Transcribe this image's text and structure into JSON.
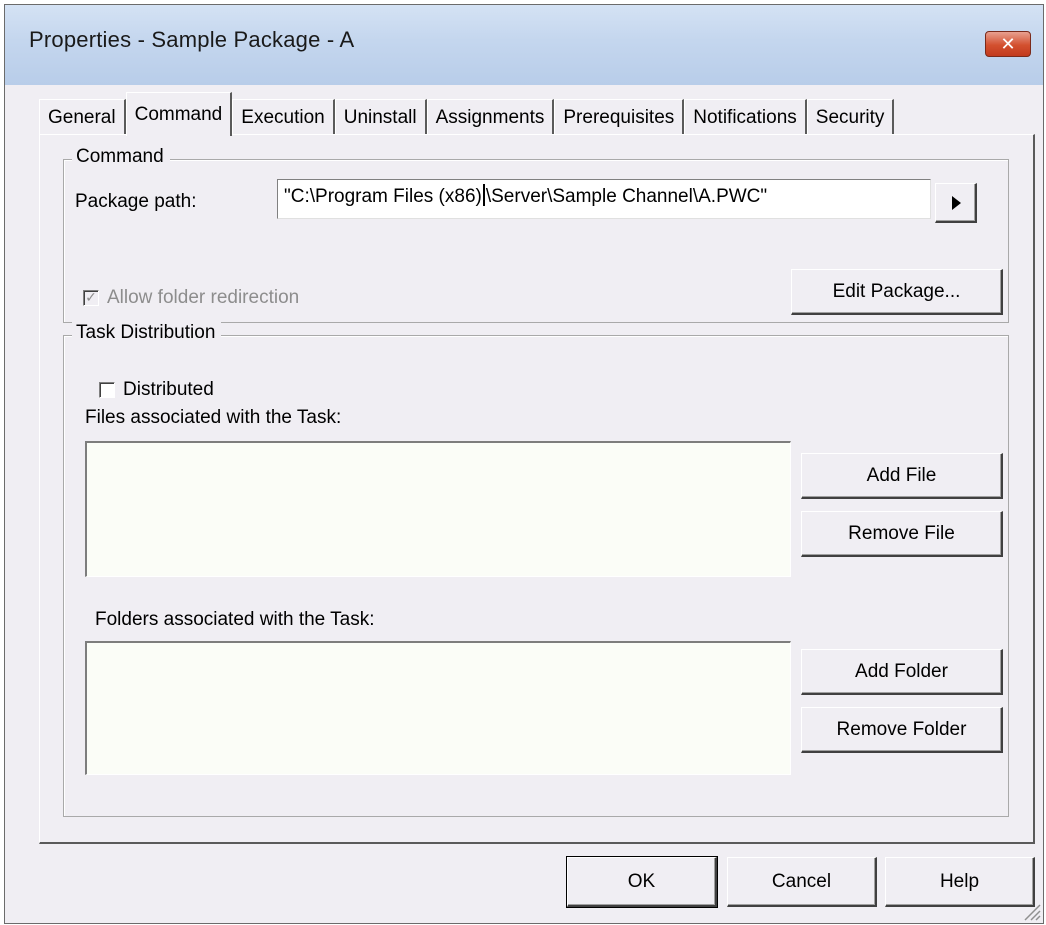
{
  "window": {
    "title": "Properties - Sample Package - A",
    "close_symbol": "✕"
  },
  "tabs": [
    {
      "label": "General",
      "active": false
    },
    {
      "label": "Command",
      "active": true
    },
    {
      "label": "Execution",
      "active": false
    },
    {
      "label": "Uninstall",
      "active": false
    },
    {
      "label": "Assignments",
      "active": false
    },
    {
      "label": "Prerequisites",
      "active": false
    },
    {
      "label": "Notifications",
      "active": false
    },
    {
      "label": "Security",
      "active": false
    }
  ],
  "command_group": {
    "title": "Command",
    "package_path_label": "Package path:",
    "package_path_value_before_cursor": "\"C:\\Program Files (x86)",
    "package_path_value_after_cursor": "\\Server\\Sample Channel\\A.PWC\"",
    "browse_icon": "play-arrow-icon",
    "allow_redirection_label": "Allow folder redirection",
    "allow_redirection_checked": true,
    "allow_redirection_enabled": false,
    "edit_package_label": "Edit Package..."
  },
  "task_group": {
    "title": "Task Distribution",
    "distributed_label": "Distributed",
    "distributed_checked": false,
    "files_label": "Files associated with the Task:",
    "add_file_label": "Add File",
    "remove_file_label": "Remove File",
    "folders_label": "Folders associated with the Task:",
    "add_folder_label": "Add Folder",
    "remove_folder_label": "Remove Folder"
  },
  "footer": {
    "ok_label": "OK",
    "cancel_label": "Cancel",
    "help_label": "Help"
  },
  "colors": {
    "dialog_bg": "#f0eef3",
    "titlebar": "#c4d6ee",
    "close_button": "#d3502f"
  }
}
